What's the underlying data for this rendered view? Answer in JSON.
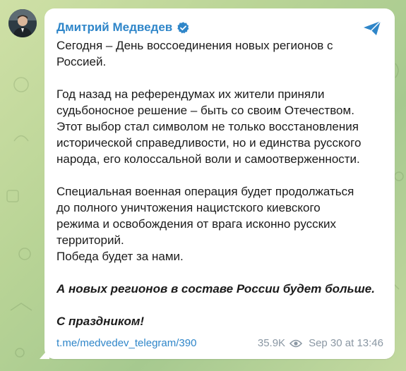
{
  "message": {
    "sender": "Дмитрий Медведев",
    "verified": true,
    "paragraphs": [
      [
        "Сегодня – День воссоединения новых регионов с",
        "Россией."
      ],
      [
        "Год назад на референдумах их жители приняли",
        "судьбоносное решение – быть со своим Отечеством.",
        "Этот выбор стал символом не только восстановления",
        "исторической справедливости, но и единства русского",
        "народа, его колоссальной воли и самоотверженности."
      ],
      [
        "Специальная военная операция будет продолжаться",
        "до полного уничтожения нацистского киевского",
        "режима и освобождения от врага исконно русских",
        "территорий.",
        "Победа будет за нами."
      ]
    ],
    "italic_lines": [
      "А новых регионов в составе России будет больше.",
      "С праздником!"
    ],
    "link": "t.me/medvedev_telegram/390",
    "views": "35.9K",
    "timestamp": "Sep 30 at 13:46"
  },
  "colors": {
    "accent": "#2f86c9",
    "text": "#1b1b1b",
    "meta": "#8a97a3",
    "bubble": "#ffffff"
  },
  "icons": {
    "verified": "verified-badge-icon",
    "share": "share-arrow-icon",
    "views": "eye-icon"
  }
}
